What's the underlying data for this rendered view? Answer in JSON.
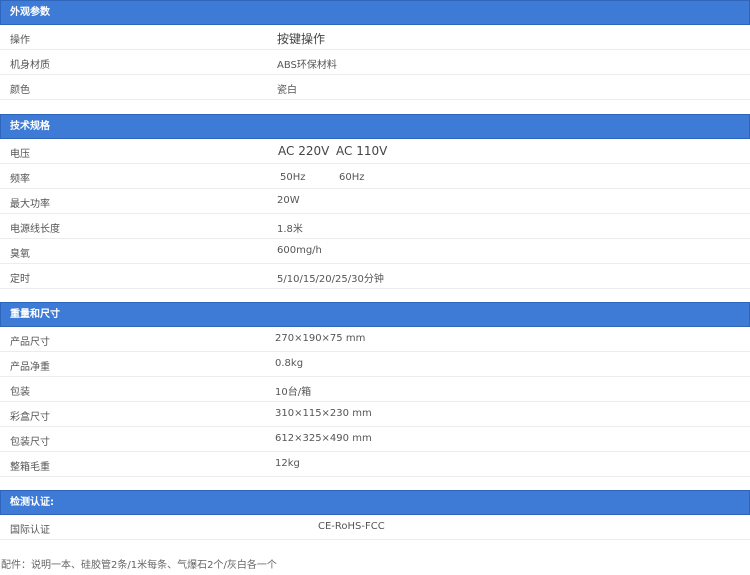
{
  "sections": [
    {
      "title": "外观参数",
      "rows": [
        {
          "label": "操作",
          "value": "按键操作"
        },
        {
          "label": "机身材质",
          "value": "ABS环保材料"
        },
        {
          "label": "颜色",
          "value": "瓷白"
        }
      ]
    },
    {
      "title": "技术规格",
      "rows": [
        {
          "label": "电压",
          "value": "AC 220V",
          "value2": "AC 110V"
        },
        {
          "label": "频率",
          "value": "50Hz",
          "value2": "60Hz"
        },
        {
          "label": "最大功率",
          "value": "20W"
        },
        {
          "label": "电源线长度",
          "value": "1.8米"
        },
        {
          "label": "臭氧",
          "value": "600mg/h"
        },
        {
          "label": "定时",
          "value": "5/10/15/20/25/30分钟"
        }
      ]
    },
    {
      "title": "重量和尺寸",
      "rows": [
        {
          "label": "产品尺寸",
          "value": "270×190×75 mm"
        },
        {
          "label": "产品净重",
          "value": "0.8kg"
        },
        {
          "label": "包装",
          "value": "10台/箱"
        },
        {
          "label": "彩盒尺寸",
          "value": "310×115×230 mm"
        },
        {
          "label": "包装尺寸",
          "value": "612×325×490 mm"
        },
        {
          "label": "整箱毛重",
          "value": "12kg"
        }
      ]
    },
    {
      "title": "检测认证:",
      "rows": [
        {
          "label": "国际认证",
          "value": "CE-RoHS-FCC"
        }
      ]
    }
  ],
  "footnote": "配件：说明一本、硅胶管2条/1米每条、气爆石2个/灰白各一个"
}
